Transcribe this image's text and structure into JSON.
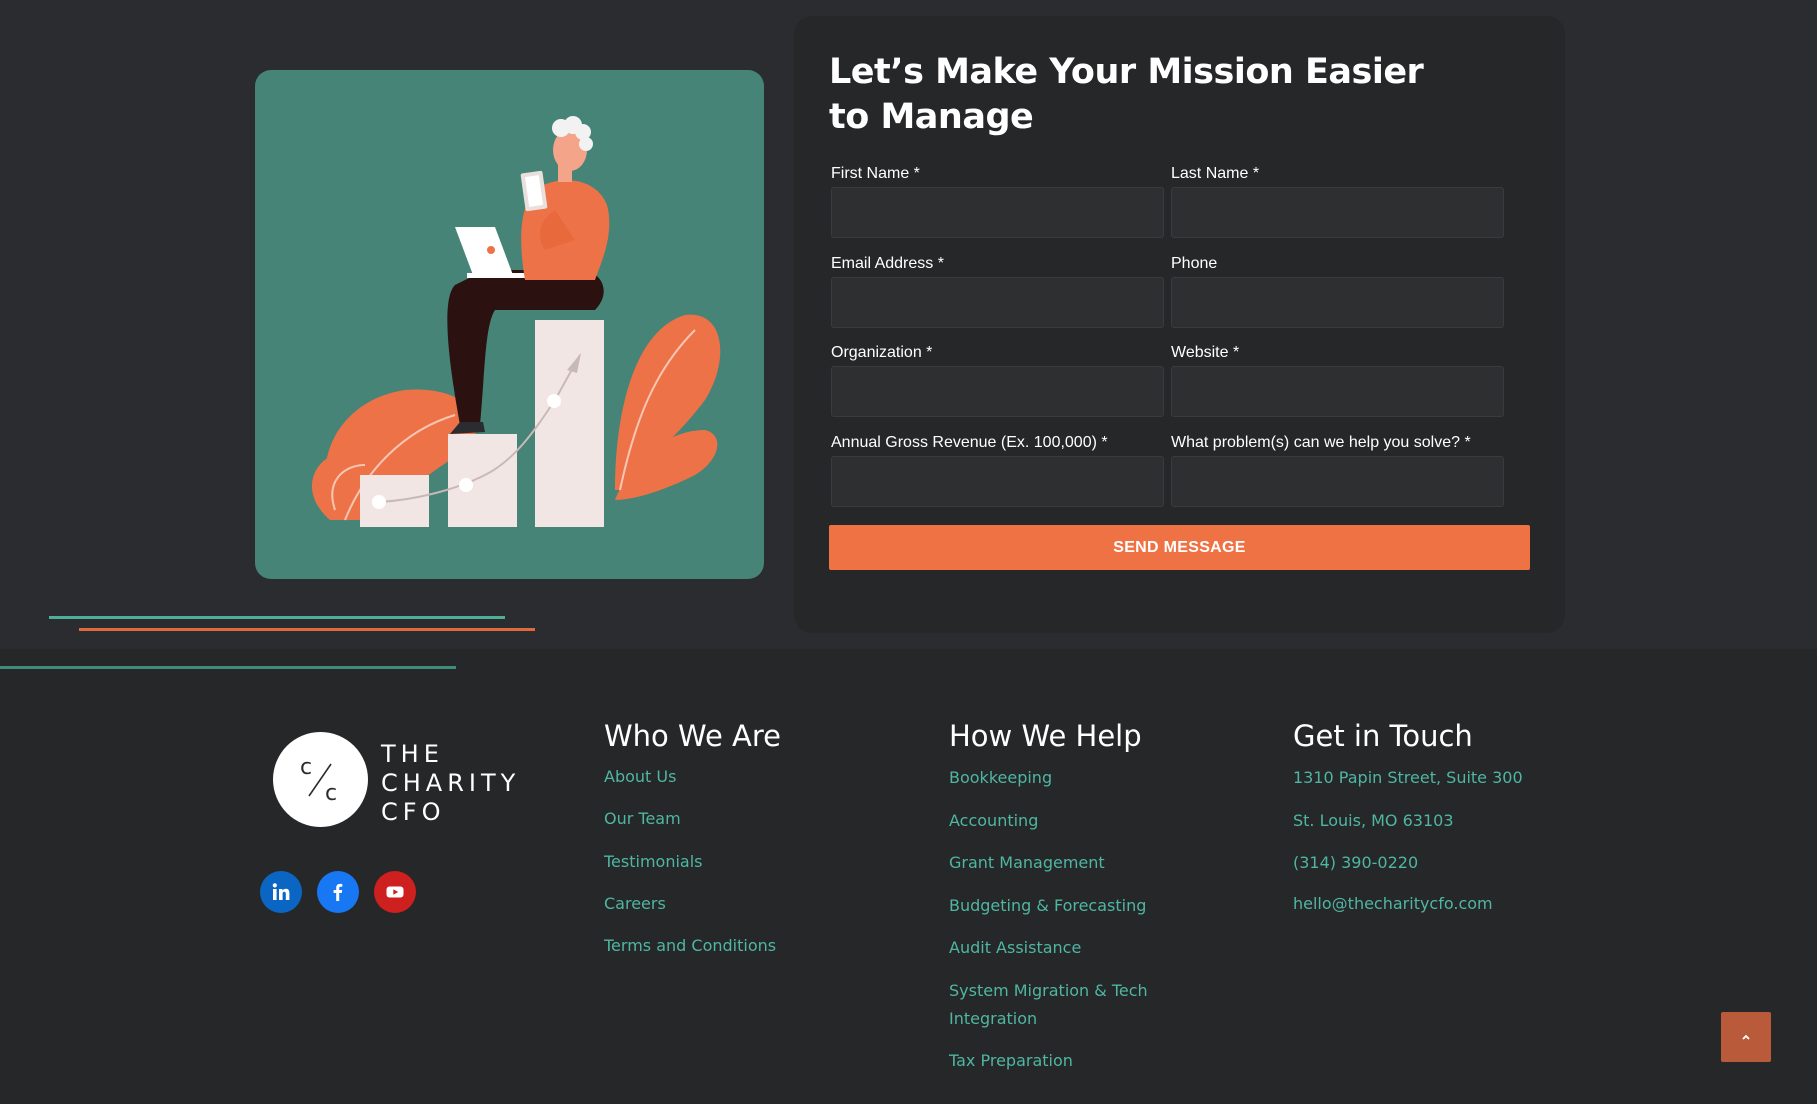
{
  "contact_form": {
    "title": "Let’s Make Your Mission Easier to Manage",
    "fields": {
      "first_name": {
        "label": "First Name *",
        "value": ""
      },
      "last_name": {
        "label": "Last Name *",
        "value": ""
      },
      "email": {
        "label": "Email Address *",
        "value": ""
      },
      "phone": {
        "label": "Phone",
        "value": ""
      },
      "organization": {
        "label": "Organization *",
        "value": ""
      },
      "website": {
        "label": "Website *",
        "value": ""
      },
      "revenue": {
        "label": "Annual Gross Revenue (Ex. 100,000) *",
        "value": ""
      },
      "problem": {
        "label": "What problem(s) can we help you solve? *",
        "value": ""
      }
    },
    "submit_label": "SEND MESSAGE"
  },
  "footer": {
    "logo": {
      "monogram": "C/C",
      "line1": "THE",
      "line2": "CHARITY",
      "line3": "CFO"
    },
    "social": [
      {
        "icon": "linkedin-icon",
        "color": "#0a66c2"
      },
      {
        "icon": "facebook-icon",
        "color": "#1877f2"
      },
      {
        "icon": "youtube-icon",
        "color": "#cd201f"
      }
    ],
    "who_we_are": {
      "heading": "Who We Are",
      "links": [
        "About Us",
        "Our Team",
        "Testimonials",
        "Careers",
        "Terms and Conditions"
      ]
    },
    "how_we_help": {
      "heading": "How We Help",
      "links": [
        "Bookkeeping",
        "Accounting",
        "Grant Management",
        "Budgeting & Forecasting",
        "Audit Assistance",
        "System Migration & Tech",
        "Integration",
        "Tax Preparation"
      ]
    },
    "get_in_touch": {
      "heading": "Get in Touch",
      "links": [
        "1310 Papin Street, Suite 300",
        "St. Louis, MO 63103",
        "(314) 390-0220",
        "hello@thecharitycfo.com"
      ]
    }
  },
  "scroll_top": {
    "icon": "chevron-up-icon"
  },
  "colors": {
    "accent_orange": "#ef7244",
    "link_teal": "#4fb6a3",
    "illustration_bg": "#458477",
    "page_bg": "#2b2c30",
    "card_bg": "#262729"
  }
}
